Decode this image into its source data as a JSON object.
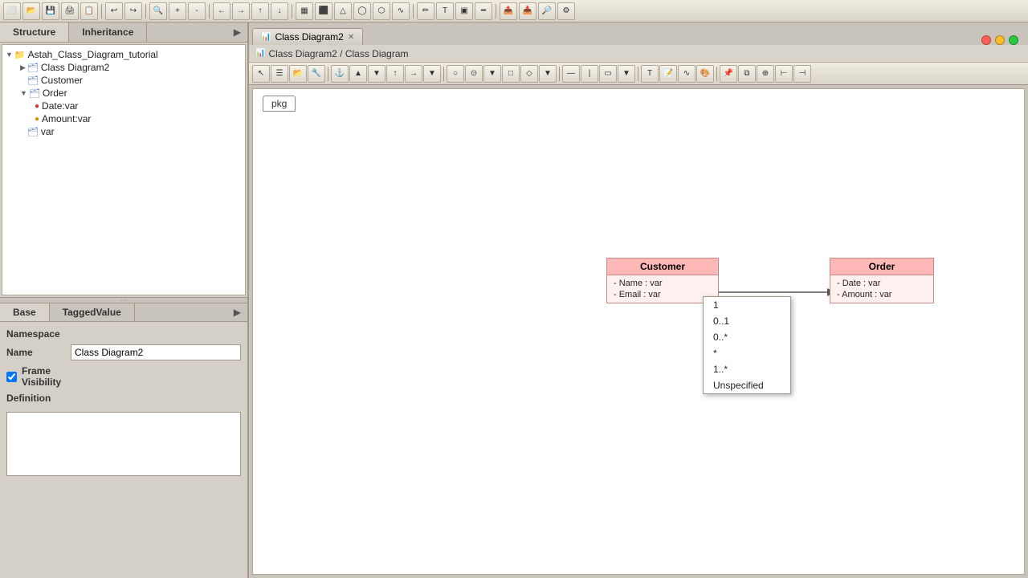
{
  "app": {
    "title": "Astah Class Diagram Tutorial"
  },
  "toolbar_top": {
    "buttons": [
      "⬜",
      "💾",
      "📋",
      "🖨",
      "📷",
      "◀",
      "▶",
      "⬅",
      "➡",
      "⊕",
      "⊖",
      "🔍",
      "🔎",
      "📊",
      "←",
      "→",
      "↑",
      "↓",
      "⬛",
      "⬛",
      "⬛",
      "⬛",
      "⬛",
      "⬛"
    ]
  },
  "left_panel": {
    "top_tabs": [
      {
        "id": "structure",
        "label": "Structure",
        "active": true
      },
      {
        "id": "inheritance",
        "label": "Inheritance",
        "active": false
      }
    ],
    "tree": {
      "root": {
        "label": "Astah_Class_Diagram_tutorial",
        "expanded": true,
        "children": [
          {
            "label": "Class Diagram2",
            "icon": "class",
            "expanded": false,
            "children": []
          },
          {
            "label": "Customer",
            "icon": "class",
            "expanded": false,
            "children": []
          },
          {
            "label": "Order",
            "icon": "class",
            "expanded": true,
            "children": [
              {
                "label": "Date:var",
                "icon": "attr-red",
                "children": []
              },
              {
                "label": "Amount:var",
                "icon": "attr-yellow",
                "children": []
              }
            ]
          },
          {
            "label": "var",
            "icon": "class",
            "expanded": false,
            "children": []
          }
        ]
      }
    },
    "bottom_tabs": [
      {
        "id": "base",
        "label": "Base",
        "active": true
      },
      {
        "id": "taggedvalue",
        "label": "TaggedValue",
        "active": false
      }
    ],
    "properties": {
      "namespace_label": "Namespace",
      "name_label": "Name",
      "name_value": "Class Diagram2",
      "frame_visibility_label": "Frame Visibility",
      "frame_visibility_checked": true,
      "definition_label": "Definition"
    }
  },
  "diagram_area": {
    "tab_label": "Class Diagram2",
    "tab_icon": "📊",
    "breadcrumb": "Class Diagram2 / Class Diagram",
    "pkg_label": "pkg",
    "customer_class": {
      "name": "Customer",
      "attributes": [
        "- Name : var",
        "- Email : var"
      ]
    },
    "order_class": {
      "name": "Order",
      "attributes": [
        "- Date : var",
        "- Amount : var"
      ]
    },
    "multiplicity_dropdown": {
      "items": [
        "1",
        "0..1",
        "0..*",
        "*",
        "1..*",
        "Unspecified"
      ],
      "selected": null
    }
  },
  "window_controls": {
    "red": "close",
    "yellow": "minimize",
    "green": "maximize"
  }
}
